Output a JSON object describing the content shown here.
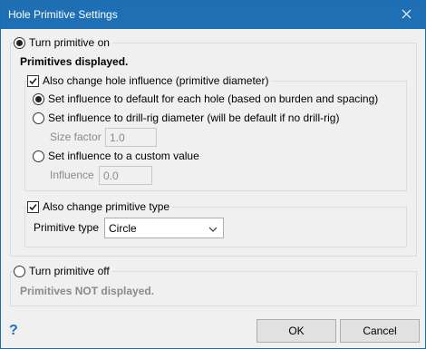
{
  "window": {
    "title": "Hole Primitive Settings",
    "close_glyph": "✕"
  },
  "turn_on": {
    "label": "Turn primitive on",
    "selected": true,
    "status": "Primitives displayed.",
    "influence": {
      "label": "Also change hole influence (primitive diameter)",
      "checked": true,
      "options": [
        {
          "label": "Set influence to default for each hole (based on burden and spacing)",
          "selected": true
        },
        {
          "label": "Set influence to drill-rig diameter (will be default if no drill-rig)",
          "selected": false
        },
        {
          "label": "Set influence to a custom value",
          "selected": false
        }
      ],
      "size_factor": {
        "label": "Size factor",
        "value": "1.0"
      },
      "influence_value": {
        "label": "Influence",
        "value": "0.0"
      }
    },
    "type": {
      "label": "Also change primitive type",
      "checked": true,
      "field_label": "Primitive type",
      "selected": "Circle"
    }
  },
  "turn_off": {
    "label": "Turn primitive off",
    "selected": false,
    "status": "Primitives NOT displayed."
  },
  "buttons": {
    "help": "?",
    "ok": "OK",
    "cancel": "Cancel"
  }
}
